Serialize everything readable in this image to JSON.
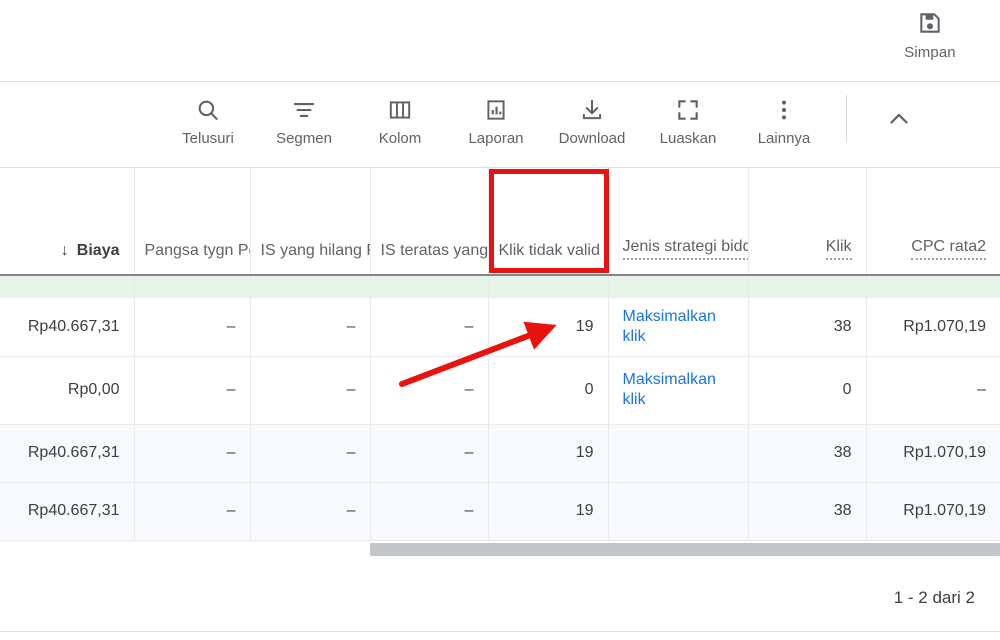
{
  "topbar": {
    "save": {
      "label": "Simpan",
      "icon": "save-icon"
    }
  },
  "toolbar": {
    "items": [
      {
        "label": "Telusuri",
        "icon": "search-icon"
      },
      {
        "label": "Segmen",
        "icon": "segment-icon"
      },
      {
        "label": "Kolom",
        "icon": "columns-icon"
      },
      {
        "label": "Laporan",
        "icon": "report-chart-icon"
      },
      {
        "label": "Download",
        "icon": "download-icon"
      },
      {
        "label": "Luaskan",
        "icon": "expand-icon"
      },
      {
        "label": "Lainnya",
        "icon": "more-vert-icon"
      }
    ],
    "collapse_icon": "chevron-up-icon"
  },
  "table": {
    "columns": [
      {
        "label": "Biaya",
        "sorted": true,
        "sort_icon": "arrow-down-icon",
        "dotted": false,
        "clipped": false
      },
      {
        "label": "Pangsa tygn Penelusuran",
        "sorted": false,
        "dotted": false,
        "clipped": true
      },
      {
        "label": "IS yang hilang Penelusuran (peringkat)",
        "sorted": false,
        "dotted": false,
        "clipped": true
      },
      {
        "label": "IS teratas yang hilang Penelusuran (anggaran)",
        "sorted": false,
        "dotted": false,
        "clipped": true
      },
      {
        "label": "Klik tidak valid",
        "sorted": false,
        "dotted": false,
        "clipped": false,
        "highlighted": true
      },
      {
        "label": "Jenis strategi bidding",
        "sorted": false,
        "dotted": true,
        "clipped": false,
        "align": "left"
      },
      {
        "label": "Klik",
        "sorted": false,
        "dotted": true,
        "clipped": false
      },
      {
        "label": "CPC rata2",
        "sorted": false,
        "dotted": true,
        "clipped": false
      }
    ],
    "rows": [
      {
        "type": "data",
        "cells": [
          "Rp40.667,31",
          "–",
          "–",
          "–",
          "19",
          "Maksimalkan klik",
          "38",
          "Rp1.070,19"
        ],
        "link_cell": 5
      },
      {
        "type": "data",
        "cells": [
          "Rp0,00",
          "–",
          "–",
          "–",
          "0",
          "Maksimalkan klik",
          "0",
          "–"
        ],
        "link_cell": 5
      },
      {
        "type": "total",
        "cells": [
          "Rp40.667,31",
          "–",
          "–",
          "–",
          "19",
          "",
          "38",
          "Rp1.070,19"
        ],
        "link_cell": -1
      },
      {
        "type": "total",
        "cells": [
          "Rp40.667,31",
          "–",
          "–",
          "–",
          "19",
          "",
          "38",
          "Rp1.070,19"
        ],
        "link_cell": -1
      }
    ]
  },
  "footer": {
    "pagination": "1 - 2 dari 2"
  },
  "annotations": {
    "highlight_box": {
      "color": "#e8120e",
      "target_column": "Klik tidak valid"
    },
    "arrow": {
      "color": "#e8120e",
      "from": "Rp0,00 row area",
      "to": "19 in Klik tidak valid"
    }
  },
  "colors": {
    "link": "#1a73e8",
    "summary_band": "#e6f4ea",
    "annotation_red": "#e8120e",
    "text": "#3c4043",
    "muted_text": "#5f6368"
  }
}
